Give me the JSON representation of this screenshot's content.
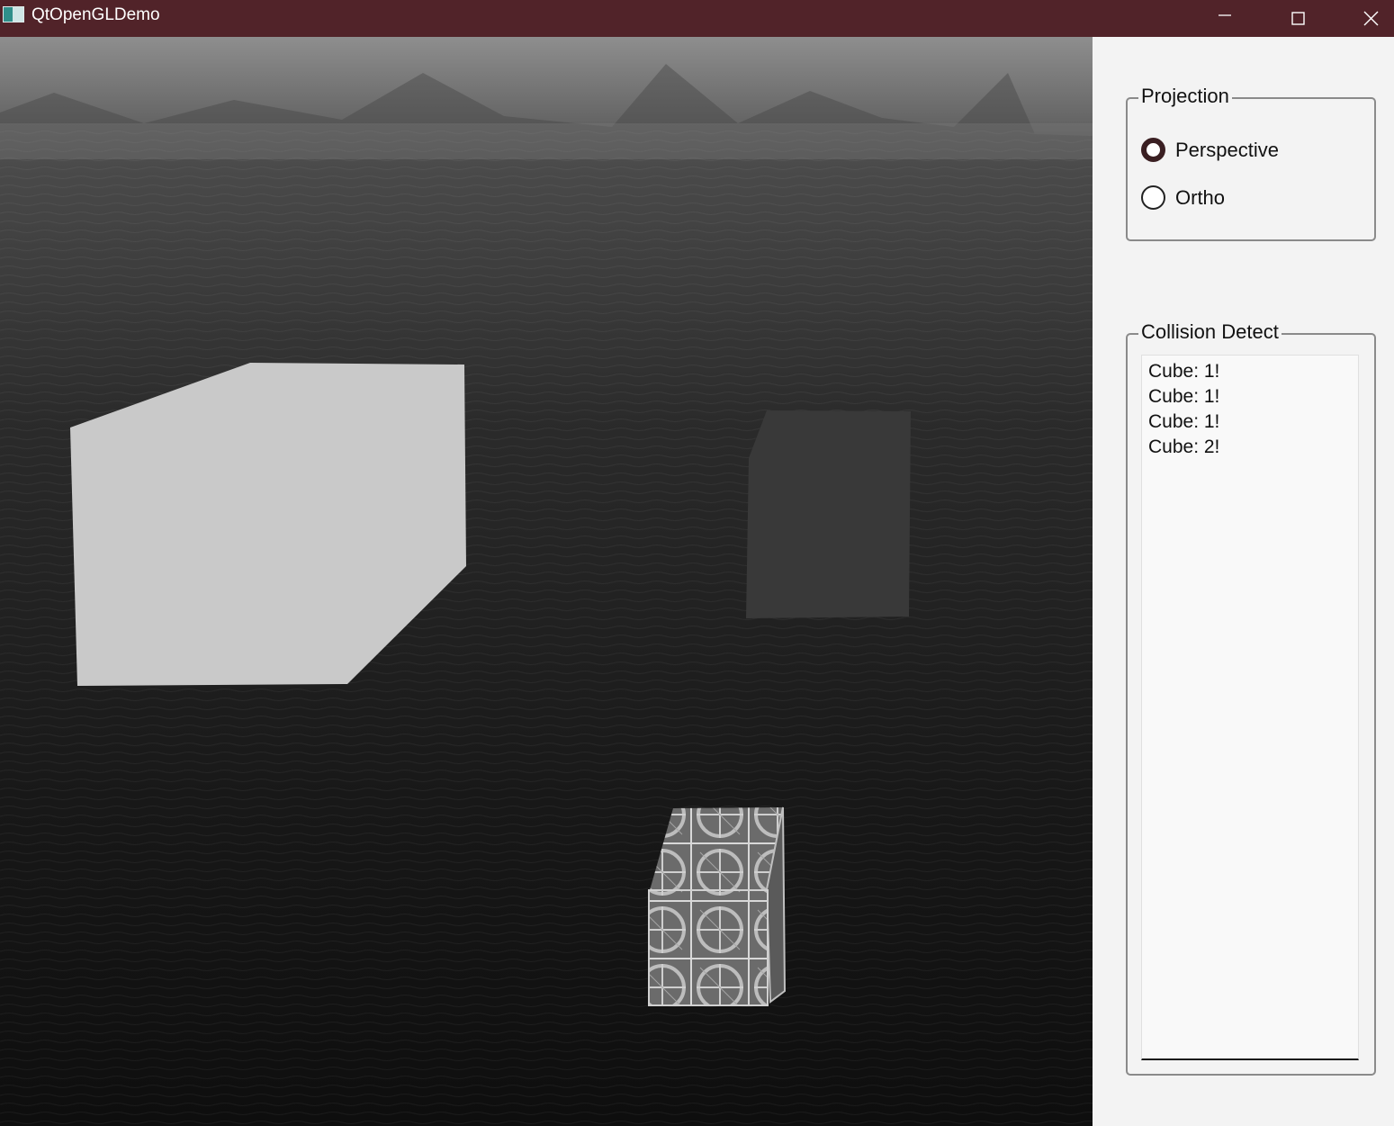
{
  "window": {
    "title": "QtOpenGLDemo",
    "titlebar_color": "#512329",
    "controls": [
      "minimize-icon",
      "maximize-icon",
      "close-icon"
    ]
  },
  "viewport": {
    "scene": "skybox-water-mountains",
    "objects": [
      {
        "kind": "cube",
        "shade": "#c9c9c9"
      },
      {
        "kind": "cube",
        "shade": "#393939"
      },
      {
        "kind": "textured-cube",
        "shade": "#8a8a8a"
      }
    ]
  },
  "projection": {
    "title": "Projection",
    "options": [
      {
        "label": "Perspective",
        "checked": true
      },
      {
        "label": "Ortho",
        "checked": false
      }
    ]
  },
  "collision": {
    "title": "Collision Detect",
    "lines": [
      "Cube: 1!",
      "Cube: 1!",
      "Cube: 1!",
      "Cube: 2!"
    ]
  }
}
